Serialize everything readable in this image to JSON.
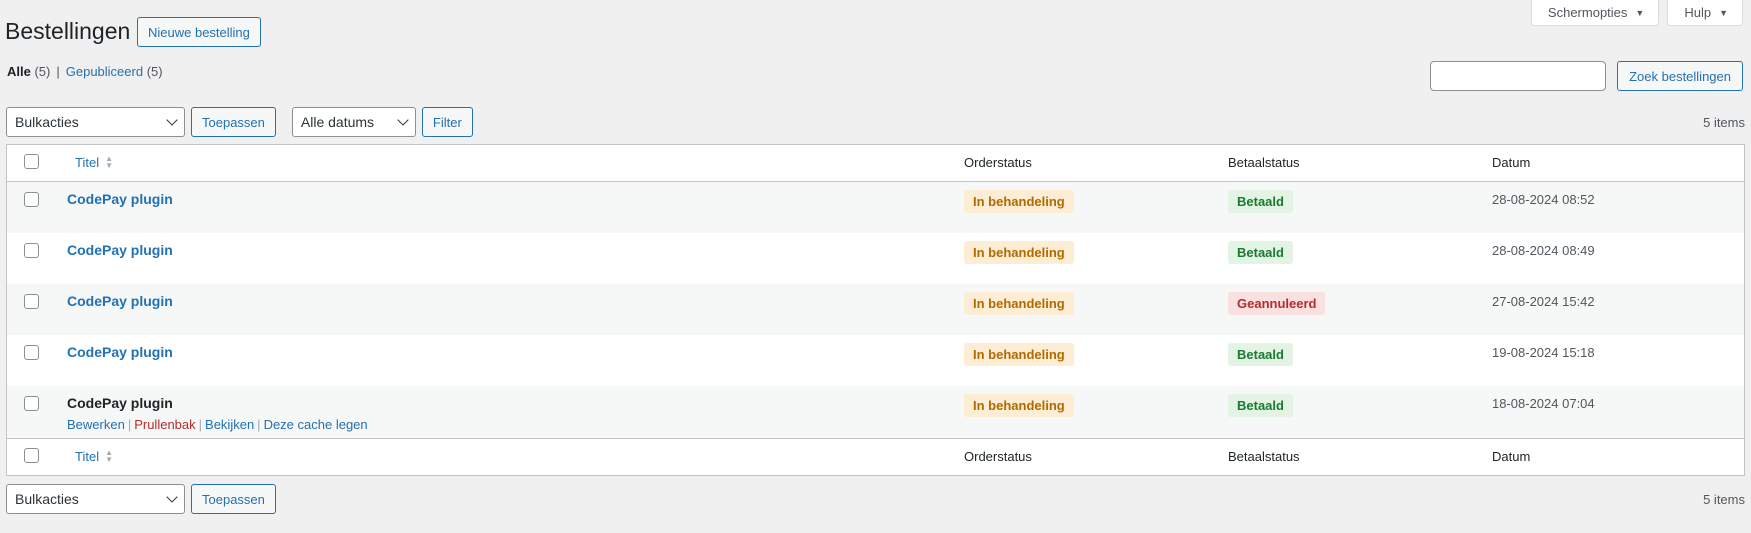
{
  "screen_options": {
    "screen_label": "Schermopties",
    "help_label": "Hulp"
  },
  "page": {
    "title": "Bestellingen",
    "add_new": "Nieuwe bestelling"
  },
  "views": {
    "all_label": "Alle",
    "all_count": "(5)",
    "separator": "|",
    "published_label": "Gepubliceerd",
    "published_count": "(5)"
  },
  "search": {
    "value": "",
    "button": "Zoek bestellingen"
  },
  "tablenav_top": {
    "bulk_action": "Bulkacties",
    "apply": "Toepassen",
    "date_filter": "Alle datums",
    "filter": "Filter",
    "items": "5 items"
  },
  "tablenav_bottom": {
    "bulk_action": "Bulkacties",
    "apply": "Toepassen",
    "items": "5 items"
  },
  "columns": {
    "title": "Titel",
    "order_status": "Orderstatus",
    "payment_status": "Betaalstatus",
    "date": "Datum"
  },
  "orders": [
    {
      "title": "CodePay plugin",
      "order_status": "In behandeling",
      "payment_status": "Betaald",
      "date": "28-08-2024 08:52"
    },
    {
      "title": "CodePay plugin",
      "order_status": "In behandeling",
      "payment_status": "Betaald",
      "date": "28-08-2024 08:49"
    },
    {
      "title": "CodePay plugin",
      "order_status": "In behandeling",
      "payment_status": "Geannuleerd",
      "date": "27-08-2024 15:42"
    },
    {
      "title": "CodePay plugin",
      "order_status": "In behandeling",
      "payment_status": "Betaald",
      "date": "19-08-2024 15:18"
    },
    {
      "title": "CodePay plugin",
      "order_status": "In behandeling",
      "payment_status": "Betaald",
      "date": "18-08-2024 07:04"
    }
  ],
  "row_actions": {
    "edit": "Bewerken",
    "trash": "Prullenbak",
    "view": "Bekijken",
    "clear_cache": "Deze cache legen",
    "separator": "|"
  },
  "colors": {
    "link": "#2271b1",
    "processing_bg": "#fcedd4",
    "paid_bg": "#e3f4e5",
    "cancelled_bg": "#fbe0e0"
  }
}
